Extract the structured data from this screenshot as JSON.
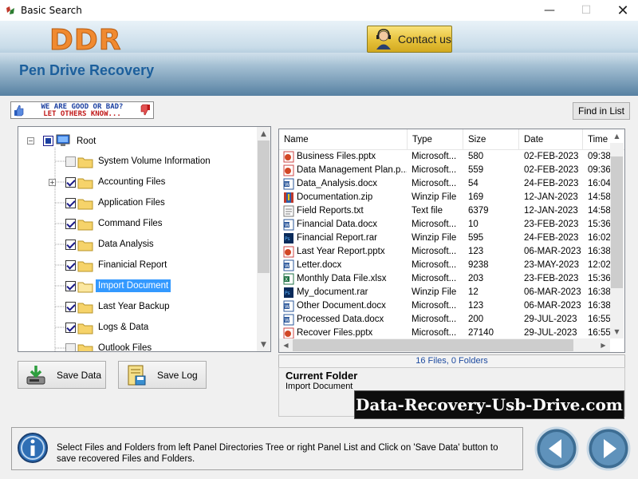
{
  "window": {
    "title": "Basic Search",
    "minimize": "—",
    "maximize": "☐",
    "close": "✕"
  },
  "header": {
    "logo": "DDR",
    "product": "Pen Drive Recovery",
    "contact_label": "Contact us"
  },
  "feedback": {
    "line1": "WE ARE GOOD OR BAD?",
    "line2": "LET OTHERS KNOW..."
  },
  "find_button": "Find in List",
  "tree": {
    "root": "Root",
    "items": [
      {
        "label": "System Volume Information",
        "checked": "grey"
      },
      {
        "label": "Accounting Files",
        "checked": "yes",
        "expandable": true
      },
      {
        "label": "Application Files",
        "checked": "yes"
      },
      {
        "label": "Command Files",
        "checked": "yes"
      },
      {
        "label": "Data Analysis",
        "checked": "yes"
      },
      {
        "label": "Finanicial Report",
        "checked": "yes"
      },
      {
        "label": "Import Document",
        "checked": "yes",
        "selected": true
      },
      {
        "label": "Last Year Backup",
        "checked": "yes"
      },
      {
        "label": "Logs & Data",
        "checked": "yes"
      },
      {
        "label": "Outlook Files",
        "checked": "grey"
      }
    ]
  },
  "buttons": {
    "save_data": "Save Data",
    "save_log": "Save Log"
  },
  "file_list": {
    "columns": [
      "Name",
      "Type",
      "Size",
      "Date",
      "Time"
    ],
    "rows": [
      {
        "icon": "pptx",
        "name": "Business Files.pptx",
        "type": "Microsoft...",
        "size": "580",
        "date": "02-FEB-2023",
        "time": "09:38"
      },
      {
        "icon": "pptx",
        "name": "Data Management Plan.p...",
        "type": "Microsoft...",
        "size": "559",
        "date": "02-FEB-2023",
        "time": "09:36"
      },
      {
        "icon": "docx",
        "name": "Data_Analysis.docx",
        "type": "Microsoft...",
        "size": "54",
        "date": "24-FEB-2023",
        "time": "16:04"
      },
      {
        "icon": "zip",
        "name": "Documentation.zip",
        "type": "Winzip File",
        "size": "169",
        "date": "12-JAN-2023",
        "time": "14:58"
      },
      {
        "icon": "txt",
        "name": "Field Reports.txt",
        "type": "Text file",
        "size": "6379",
        "date": "12-JAN-2023",
        "time": "14:58"
      },
      {
        "icon": "docx",
        "name": "Financial Data.docx",
        "type": "Microsoft...",
        "size": "10",
        "date": "23-FEB-2023",
        "time": "15:36"
      },
      {
        "icon": "rar",
        "name": "Financial Report.rar",
        "type": "Winzip File",
        "size": "595",
        "date": "24-FEB-2023",
        "time": "16:02"
      },
      {
        "icon": "pptx",
        "name": "Last Year Report.pptx",
        "type": "Microsoft...",
        "size": "123",
        "date": "06-MAR-2023",
        "time": "16:38"
      },
      {
        "icon": "docx",
        "name": "Letter.docx",
        "type": "Microsoft...",
        "size": "9238",
        "date": "23-MAY-2023",
        "time": "12:02"
      },
      {
        "icon": "xlsx",
        "name": "Monthly Data File.xlsx",
        "type": "Microsoft...",
        "size": "203",
        "date": "23-FEB-2023",
        "time": "15:36"
      },
      {
        "icon": "rar",
        "name": "My_document.rar",
        "type": "Winzip File",
        "size": "12",
        "date": "06-MAR-2023",
        "time": "16:38"
      },
      {
        "icon": "docx",
        "name": "Other Document.docx",
        "type": "Microsoft...",
        "size": "123",
        "date": "06-MAR-2023",
        "time": "16:38"
      },
      {
        "icon": "docx",
        "name": "Processed Data.docx",
        "type": "Microsoft...",
        "size": "200",
        "date": "29-JUL-2023",
        "time": "16:55"
      },
      {
        "icon": "pptx",
        "name": "Recover Files.pptx",
        "type": "Microsoft...",
        "size": "27140",
        "date": "29-JUL-2023",
        "time": "16:55"
      }
    ]
  },
  "count_text": "16 Files, 0 Folders",
  "current_folder": {
    "title": "Current Folder",
    "value": "Import Document"
  },
  "watermark": "Data-Recovery-Usb-Drive.com",
  "status_text": "Select Files and Folders from left Panel Directories Tree or right Panel List and Click on 'Save Data' button to save recovered Files and Folders.",
  "colors": {
    "accent": "#3399ff",
    "logo": "#f08a30",
    "product": "#1c5f9c",
    "count_text": "#1e4ba0"
  }
}
